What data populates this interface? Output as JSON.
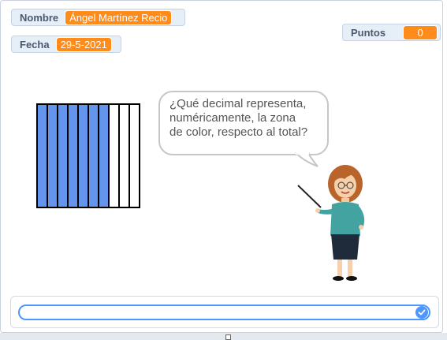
{
  "monitors": {
    "nombre": {
      "label": "Nombre",
      "value": "Ángel Martínez Recio"
    },
    "fecha": {
      "label": "Fecha",
      "value": "29-5-2021"
    },
    "puntos": {
      "label": "Puntos",
      "value": "0"
    }
  },
  "fraction_grid": {
    "total_parts": 10,
    "filled_parts": 7,
    "fill_color": "#6495ed"
  },
  "speech": {
    "line1": "¿Qué decimal representa,",
    "line2": "numéricamente, la zona",
    "line3": "de color, respecto al total?"
  },
  "answer": {
    "value": "",
    "submit_icon": "check-icon"
  },
  "colors": {
    "monitor_value": "#ff8c1a",
    "accent": "#4d97ff"
  }
}
